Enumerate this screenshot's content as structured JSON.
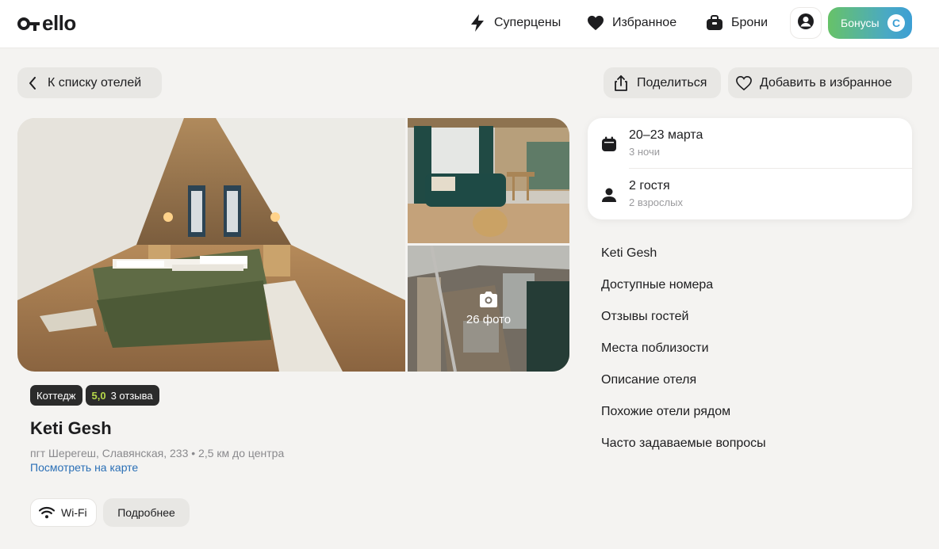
{
  "header": {
    "logo_text": "ello",
    "nav": {
      "super_prices": "Суперцены",
      "favorites": "Избранное",
      "bookings": "Брони"
    },
    "bonus_label": "Бонусы",
    "bonus_coin": "C"
  },
  "actions": {
    "back_label": "К списку отелей",
    "share_label": "Поделиться",
    "add_favorite_label": "Добавить в избранное"
  },
  "gallery": {
    "photo_count": "26 фото"
  },
  "hotel": {
    "type_badge": "Коттедж",
    "rating": "5,0",
    "reviews": "3 отзыва",
    "name": "Keti Gesh",
    "address": "пгт Шерегеш, Славянская, 233 • 2,5 км до центра",
    "map_link": "Посмотреть на карте",
    "amenity_wifi": "Wi-Fi",
    "more_label": "Подробнее"
  },
  "booking": {
    "dates": "20–23 марта",
    "nights": "3 ночи",
    "guests": "2 гостя",
    "guests_detail": "2 взрослых"
  },
  "sections": [
    "Keti Gesh",
    "Доступные номера",
    "Отзывы гостей",
    "Места поблизости",
    "Описание отеля",
    "Похожие отели рядом",
    "Часто задаваемые вопросы"
  ],
  "colors": {
    "background": "#f4f3f1",
    "header": "#ffffff",
    "button_gray": "#e8e7e4",
    "badge_dark": "#2b2b2b",
    "rating_green": "#b6d84a",
    "link_blue": "#2a6fb6",
    "bonus_gradient_start": "#67c268",
    "bonus_gradient_end": "#3c9fd4"
  }
}
